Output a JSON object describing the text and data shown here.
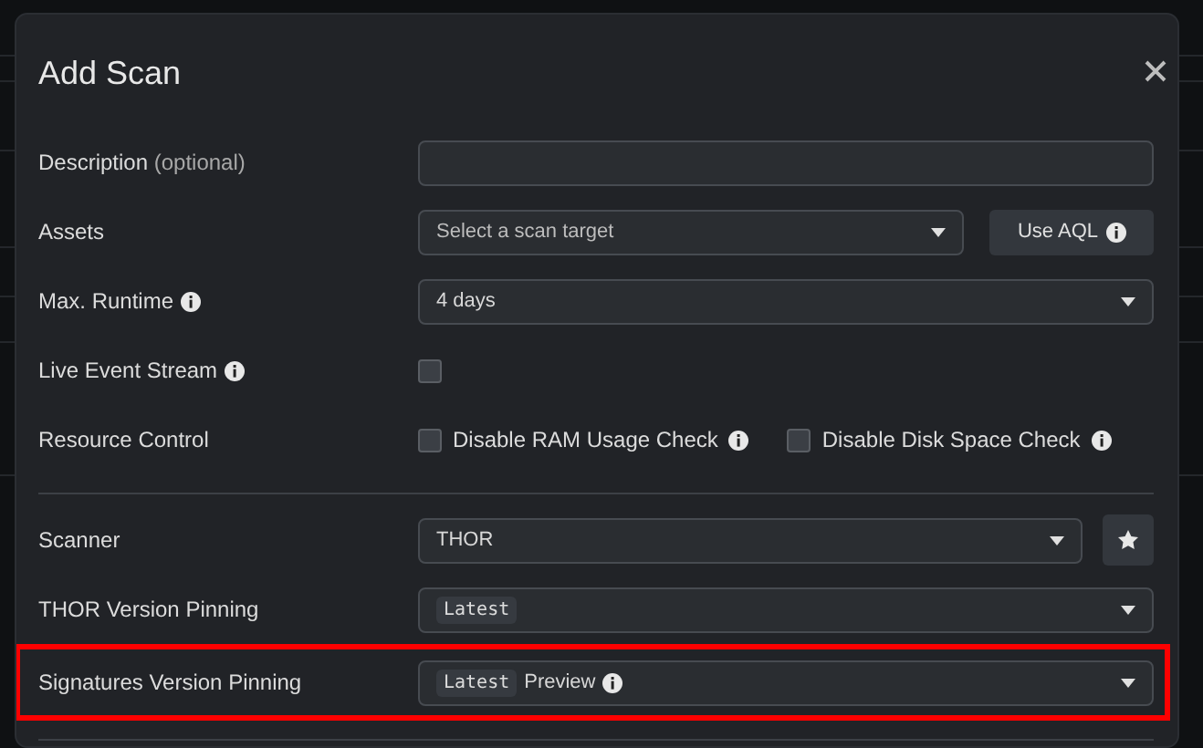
{
  "dialog": {
    "title": "Add Scan",
    "fields": [
      {
        "kind": "text",
        "label": "Description",
        "hint": "(optional)",
        "info": false
      },
      {
        "kind": "select",
        "label": "Assets",
        "info": false,
        "placeholder": "Select a scan target",
        "button": {
          "label": "Use AQL",
          "info": true
        }
      },
      {
        "kind": "select",
        "label": "Max. Runtime",
        "info": true,
        "value": "4 days"
      },
      {
        "kind": "checkbox",
        "label": "Live Event Stream",
        "info": true,
        "checked": false
      },
      {
        "kind": "checkboxes",
        "label": "Resource Control",
        "info": false,
        "options": [
          {
            "label": "Disable RAM Usage Check",
            "info": true,
            "checked": false
          },
          {
            "label": "Disable Disk Space Check",
            "info": true,
            "checked": false
          }
        ]
      },
      {
        "kind": "divider"
      },
      {
        "kind": "select",
        "label": "Scanner",
        "info": false,
        "value": "THOR",
        "star_button": true
      },
      {
        "kind": "select",
        "label": "THOR Version Pinning",
        "info": false,
        "tag": "Latest",
        "highlighted": false
      },
      {
        "kind": "select",
        "label": "Signatures Version Pinning",
        "info": false,
        "tag": "Latest",
        "value": "Preview",
        "value_info": true,
        "highlighted": true
      },
      {
        "kind": "divider"
      }
    ]
  }
}
